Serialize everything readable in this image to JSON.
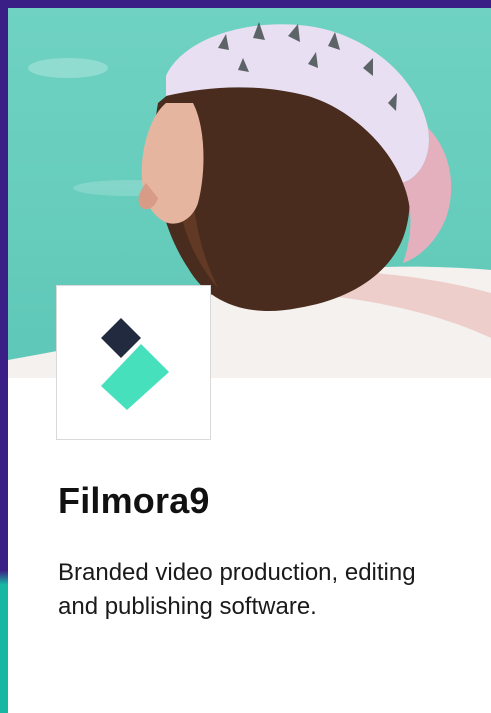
{
  "product": {
    "name": "Filmora9",
    "description": "Branded video production, editing and publishing software."
  },
  "logo": {
    "icon": "filmora-logo-icon"
  },
  "hero_image": {
    "subject": "woman-with-cap"
  },
  "colors": {
    "frame_purple": "#3a1f86",
    "sky_teal": "#6fd2c2",
    "logo_dark": "#222a3f",
    "logo_teal": "#47e0bd",
    "text": "#111111"
  }
}
